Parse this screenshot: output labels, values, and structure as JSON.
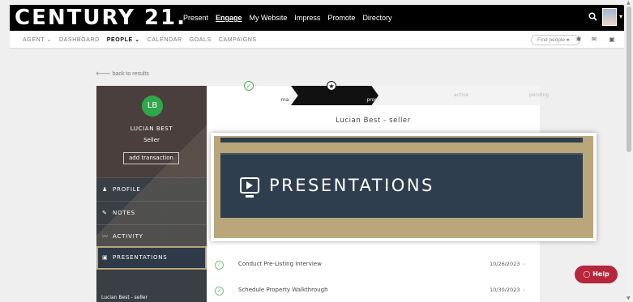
{
  "topbar": {
    "logo": "CENTURY 21.",
    "nav": [
      "Present",
      "Engage",
      "My Website",
      "Impress",
      "Promote",
      "Directory"
    ],
    "active_nav": "Engage"
  },
  "subnav": {
    "items": [
      "AGENT ⌄",
      "DASHBOARD",
      "PEOPLE ⌄",
      "CALENDAR",
      "GOALS",
      "CAMPAIGNS"
    ],
    "active": "PEOPLE ⌄",
    "search_placeholder": "Find people"
  },
  "back_link": "back to results",
  "contact": {
    "initials": "LB",
    "name": "LUCIAN BEST",
    "role": "Seller",
    "add_button": "add transaction"
  },
  "sidebar": {
    "items": [
      {
        "icon": "person-icon",
        "label": "PROFILE"
      },
      {
        "icon": "notes-icon",
        "label": "NOTES"
      },
      {
        "icon": "activity-icon",
        "label": "ACTIVITY"
      },
      {
        "icon": "presentation-icon",
        "label": "PRESENTATIONS"
      }
    ],
    "footer": "Lucian Best - seller"
  },
  "stepper": {
    "steps": [
      "marketing",
      "prospects",
      "active",
      "pending"
    ],
    "current": "prospects"
  },
  "transaction_title": "Lucian Best - seller",
  "tasks": [
    {
      "name": "Conduct Pre-Listing Interview",
      "date": "10/26/2023"
    },
    {
      "name": "Schedule Property Walkthrough",
      "date": "10/30/2023"
    }
  ],
  "zoom_callout": {
    "label": "PRESENTATIONS"
  },
  "help_label": "Help",
  "colors": {
    "gold": "#b9a67a",
    "navy": "#2f3e4e",
    "green": "#2ea84a",
    "help_red": "#b8263c"
  }
}
